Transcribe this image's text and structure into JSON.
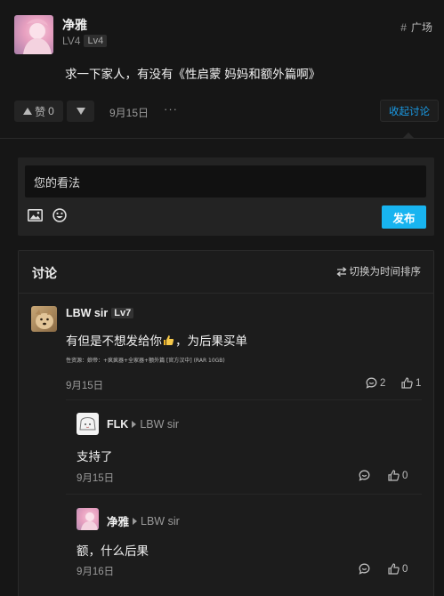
{
  "post": {
    "author": "净雅",
    "level_text": "LV4",
    "level_badge": "Lv4",
    "channel": "广场",
    "content": "求一下家人，有没有《性启蒙 妈妈和额外篇啊》",
    "like_label": "赞",
    "like_count": "0",
    "date": "9月15日",
    "more": "···",
    "collapse_label": "收起讨论"
  },
  "composer": {
    "placeholder": "您的看法",
    "submit_label": "发布"
  },
  "discussion": {
    "title": "讨论",
    "sort_label": "切换为时间排序",
    "comments": [
      {
        "author": "LBW sir",
        "level": "Lv7",
        "content_before": "有但是不想发给你",
        "content_after": "，为后果买单",
        "signature": "性资源：娘帝：+疯疯器+全家器+额外篇 [官方汉中] (RAR 10GB)",
        "date": "9月15日",
        "reply_count": "2",
        "like_count": "1"
      }
    ],
    "replies": [
      {
        "author": "FLK",
        "reply_to": "LBW sir",
        "content": "支持了",
        "date": "9月15日",
        "like_count": "0"
      },
      {
        "author": "净雅",
        "reply_to": "LBW sir",
        "content": "额，什么后果",
        "date": "9月16日",
        "like_count": "0"
      }
    ]
  },
  "colors": {
    "accent": "#1a9be6",
    "background": "#161616",
    "card": "#1c1c1c",
    "input": "#111111",
    "primary_button": "#18b4f0"
  }
}
